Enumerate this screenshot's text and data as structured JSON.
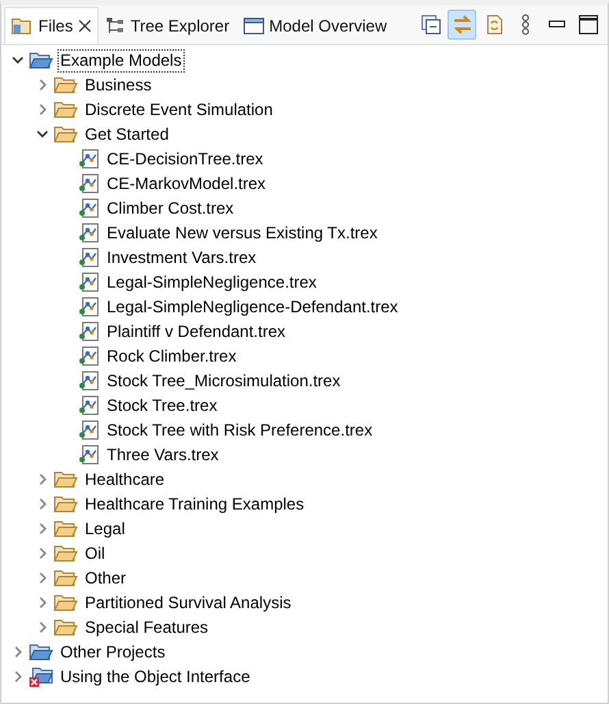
{
  "tabs": [
    {
      "label": "Files",
      "kind": "files",
      "selected": true,
      "closable": true
    },
    {
      "label": "Tree Explorer",
      "kind": "tree",
      "selected": false,
      "closable": false
    },
    {
      "label": "Model Overview",
      "kind": "overview",
      "selected": false,
      "closable": false
    }
  ],
  "toolbar": [
    {
      "kind": "collapse-all",
      "on": false
    },
    {
      "kind": "link",
      "on": true
    },
    {
      "kind": "sync",
      "on": false
    },
    {
      "kind": "view-menu",
      "on": false
    },
    {
      "kind": "minimize",
      "on": false
    },
    {
      "kind": "maximize",
      "on": false
    }
  ],
  "tree": [
    {
      "label": "Example Models",
      "kind": "project",
      "expanded": true,
      "selected": true,
      "error": false,
      "children": [
        {
          "label": "Business",
          "kind": "folder",
          "expanded": false,
          "selected": false
        },
        {
          "label": "Discrete Event Simulation",
          "kind": "folder",
          "expanded": false,
          "selected": false
        },
        {
          "label": "Get Started",
          "kind": "folder",
          "expanded": true,
          "selected": false,
          "children": [
            {
              "label": "CE-DecisionTree.trex",
              "kind": "file",
              "selected": false
            },
            {
              "label": "CE-MarkovModel.trex",
              "kind": "file",
              "selected": false
            },
            {
              "label": "Climber Cost.trex",
              "kind": "file",
              "selected": false
            },
            {
              "label": "Evaluate New versus Existing Tx.trex",
              "kind": "file",
              "selected": false
            },
            {
              "label": "Investment Vars.trex",
              "kind": "file",
              "selected": false
            },
            {
              "label": "Legal-SimpleNegligence.trex",
              "kind": "file",
              "selected": false
            },
            {
              "label": "Legal-SimpleNegligence-Defendant.trex",
              "kind": "file",
              "selected": false
            },
            {
              "label": "Plaintiff v Defendant.trex",
              "kind": "file",
              "selected": false
            },
            {
              "label": "Rock Climber.trex",
              "kind": "file",
              "selected": false
            },
            {
              "label": "Stock Tree_Microsimulation.trex",
              "kind": "file",
              "selected": false
            },
            {
              "label": "Stock Tree.trex",
              "kind": "file",
              "selected": false
            },
            {
              "label": "Stock Tree with Risk Preference.trex",
              "kind": "file",
              "selected": false
            },
            {
              "label": "Three Vars.trex",
              "kind": "file",
              "selected": false
            }
          ]
        },
        {
          "label": "Healthcare",
          "kind": "folder",
          "expanded": false,
          "selected": false
        },
        {
          "label": "Healthcare Training Examples",
          "kind": "folder",
          "expanded": false,
          "selected": false
        },
        {
          "label": "Legal",
          "kind": "folder",
          "expanded": false,
          "selected": false
        },
        {
          "label": "Oil",
          "kind": "folder",
          "expanded": false,
          "selected": false
        },
        {
          "label": "Other",
          "kind": "folder",
          "expanded": false,
          "selected": false
        },
        {
          "label": "Partitioned Survival Analysis",
          "kind": "folder",
          "expanded": false,
          "selected": false
        },
        {
          "label": "Special Features",
          "kind": "folder",
          "expanded": false,
          "selected": false
        }
      ]
    },
    {
      "label": "Other Projects",
      "kind": "project",
      "expanded": false,
      "selected": false,
      "error": false
    },
    {
      "label": "Using the Object Interface",
      "kind": "project",
      "expanded": false,
      "selected": false,
      "error": true
    }
  ]
}
